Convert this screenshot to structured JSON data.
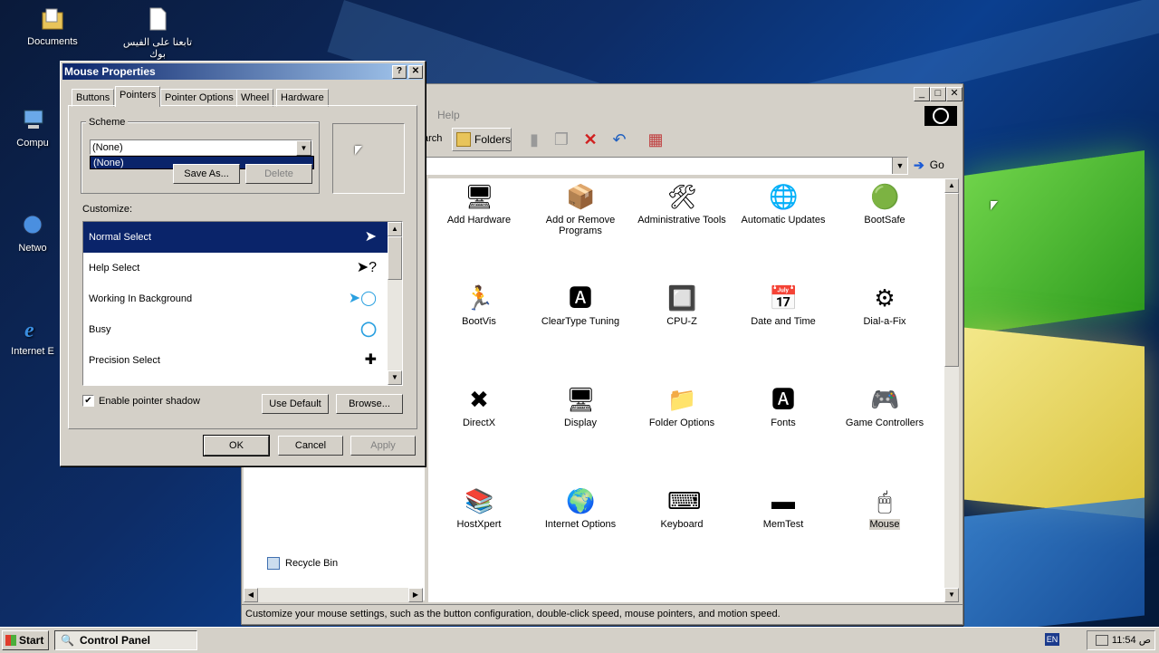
{
  "desktop": {
    "icons": [
      {
        "label": "Documents",
        "icon": "folder-icon"
      },
      {
        "label": "تابعنا على الفيس بوك",
        "icon": "file-icon"
      },
      {
        "label": "Compu",
        "icon": "computer-icon"
      },
      {
        "label": "Netwo",
        "icon": "network-icon"
      },
      {
        "label": "Internet E",
        "icon": "ie-icon"
      }
    ]
  },
  "control_panel": {
    "menu_help": "Help",
    "toolbar": {
      "search_partial": "arch",
      "folders": "Folders"
    },
    "address_value": "",
    "go": "Go",
    "left_pane": {
      "recycle_bin": "Recycle Bin"
    },
    "items": [
      {
        "label": "Add Hardware",
        "glyph": "🖥"
      },
      {
        "label": "Add or Remove Programs",
        "glyph": "📦"
      },
      {
        "label": "Administrative Tools",
        "glyph": "🛠"
      },
      {
        "label": "Automatic Updates",
        "glyph": "🌐"
      },
      {
        "label": "BootSafe",
        "glyph": "🟢"
      },
      {
        "label": "BootVis",
        "glyph": "🏃"
      },
      {
        "label": "ClearType Tuning",
        "glyph": "🅰"
      },
      {
        "label": "CPU-Z",
        "glyph": "🔲"
      },
      {
        "label": "Date and Time",
        "glyph": "📅"
      },
      {
        "label": "Dial-a-Fix",
        "glyph": "⚙"
      },
      {
        "label": "DirectX",
        "glyph": "✖"
      },
      {
        "label": "Display",
        "glyph": "🖥"
      },
      {
        "label": "Folder Options",
        "glyph": "📁"
      },
      {
        "label": "Fonts",
        "glyph": "🅰"
      },
      {
        "label": "Game Controllers",
        "glyph": "🎮"
      },
      {
        "label": "HostXpert",
        "glyph": "📚"
      },
      {
        "label": "Internet Options",
        "glyph": "🌍"
      },
      {
        "label": "Keyboard",
        "glyph": "⌨"
      },
      {
        "label": "MemTest",
        "glyph": "▬"
      },
      {
        "label": "Mouse",
        "glyph": "🖱"
      }
    ],
    "status_text": "Customize your mouse settings, such as the button configuration, double-click speed, mouse pointers, and motion speed."
  },
  "mouse_dialog": {
    "title": "Mouse Properties",
    "help_btn": "?",
    "close_btn": "✕",
    "tabs": [
      "Buttons",
      "Pointers",
      "Pointer Options",
      "Wheel",
      "Hardware"
    ],
    "active_tab": "Pointers",
    "scheme_label": "Scheme",
    "scheme_value": "(None)",
    "scheme_option_highlighted": "(None)",
    "save_as": "Save As...",
    "delete": "Delete",
    "customize_label": "Customize:",
    "cursors": [
      {
        "name": "Normal Select",
        "glyph": "➤"
      },
      {
        "name": "Help Select",
        "glyph": "➤?"
      },
      {
        "name": "Working In Background",
        "glyph": "➤◯"
      },
      {
        "name": "Busy",
        "glyph": "◯"
      },
      {
        "name": "Precision Select",
        "glyph": "✚"
      }
    ],
    "selected_cursor": "Normal Select",
    "enable_shadow": "Enable pointer shadow",
    "enable_shadow_checked": true,
    "use_default": "Use Default",
    "browse": "Browse...",
    "ok": "OK",
    "cancel": "Cancel",
    "apply": "Apply"
  },
  "taskbar": {
    "start": "Start",
    "task": "Control Panel",
    "lang": "EN",
    "clock": "11:54 ص"
  }
}
